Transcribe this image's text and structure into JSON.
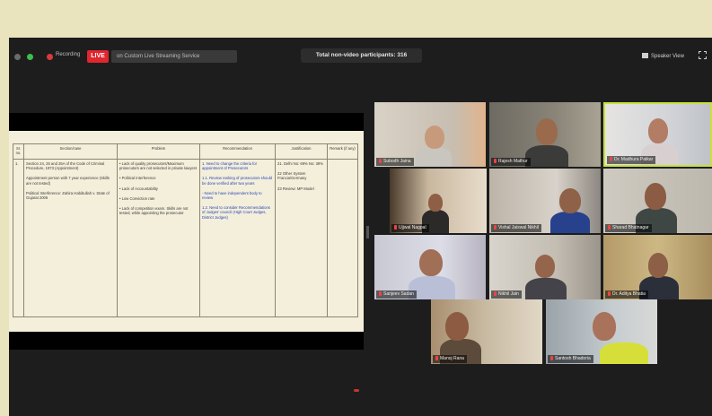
{
  "topbar": {
    "recording_label": "Recording",
    "live_badge": "LIVE",
    "stream_label": "on Custom Live Streaming Service",
    "participants": "Total non-video participants: 316",
    "speaker_view": "Speaker View"
  },
  "document": {
    "headers": [
      "Sr. no.",
      "Section/case",
      "Problem",
      "Recommendation",
      "Justification",
      "Remark (if any)"
    ],
    "row": {
      "sr": "1.",
      "section": [
        "Section 24, 25 and 25A of the Code of Criminal Procedure, 1973 (Appointment)",
        "Appointment person with 7 year experience (Skills are not tested)",
        "Political Interference: Zahira Habibullah  v. State of Gujarat 2006"
      ],
      "problem": [
        "• Lack of quality prosecutors/Maximum prosecutors are not selected in private lawyers",
        "• Political Interference",
        "• Lack of Accountability",
        "• Low Conviction rate",
        "• Lack of competition exam. Skills are not tested, while appointing the prosecutor"
      ],
      "recommendation": [
        "1. Need to change the criteria for appointment of Prosecutors",
        "1.1. Review ranking of prosecutors should be done verified after two years",
        "- Need to have independent body to review",
        "1.2. Need to consider Recommendations of Judges' council (High Court Judges, District Judges)"
      ],
      "justification": [
        "21. Delhi No: 69% No: 39%",
        "22 Other System Francia/Germany",
        "23 Review: MP Model"
      ],
      "remark": ""
    }
  },
  "participants": [
    {
      "name": "Subodh Jaina"
    },
    {
      "name": "Rajesh Mathur"
    },
    {
      "name": "Dr. Madhura Patkar"
    },
    {
      "name": "Ujjwal Nagpal"
    },
    {
      "name": "Vishal Jaiswal Nikhil"
    },
    {
      "name": "Sharad Bhatnagar"
    },
    {
      "name": "Sanjeev Sadan"
    },
    {
      "name": "Nikhil Jain"
    },
    {
      "name": "Dr. Aditya Bhatia"
    },
    {
      "name": "Manoj Rana"
    },
    {
      "name": "Santosh Bhadoria"
    }
  ],
  "colors": {
    "frame": "#e9e3be",
    "app_bg": "#1d1d1d",
    "live": "#e0262e",
    "active_speaker": "#c7e23a",
    "doc_bg": "#f4efdb",
    "doc_blue": "#2747b8"
  }
}
